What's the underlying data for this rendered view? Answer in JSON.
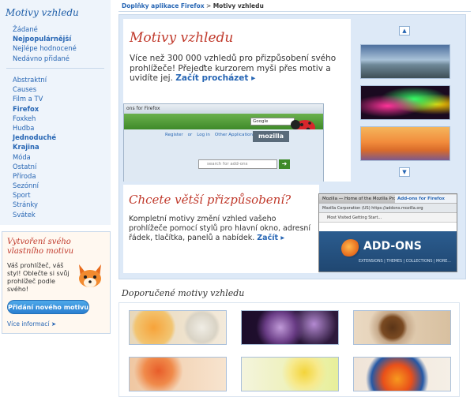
{
  "sidebar": {
    "title": "Motivy vzhledu",
    "sort_items": [
      {
        "label": "Žádané",
        "bold": false
      },
      {
        "label": "Nejpopulárnější",
        "bold": true
      },
      {
        "label": "Nejlépe hodnocené",
        "bold": false
      },
      {
        "label": "Nedávno přidané",
        "bold": false
      }
    ],
    "category_items": [
      {
        "label": "Abstraktní",
        "bold": false
      },
      {
        "label": "Causes",
        "bold": false
      },
      {
        "label": "Film a TV",
        "bold": false
      },
      {
        "label": "Firefox",
        "bold": true
      },
      {
        "label": "Foxkeh",
        "bold": false
      },
      {
        "label": "Hudba",
        "bold": false
      },
      {
        "label": "Jednoduché",
        "bold": true
      },
      {
        "label": "Krajina",
        "bold": true
      },
      {
        "label": "Móda",
        "bold": false
      },
      {
        "label": "Ostatní",
        "bold": false
      },
      {
        "label": "Příroda",
        "bold": false
      },
      {
        "label": "Sezónní",
        "bold": false
      },
      {
        "label": "Sport",
        "bold": false
      },
      {
        "label": "Stránky",
        "bold": false
      },
      {
        "label": "Svátek",
        "bold": false
      }
    ],
    "create": {
      "title": "Vytvoření svého vlastního motivu",
      "text": "Váš prohlížeč, váš styl! Oblečte si svůj prohlížeč podle svého!",
      "button": "Přidání nového motivu",
      "more": "Více informací  ➤"
    }
  },
  "breadcrumb": {
    "link": "Doplňky aplikace Firefox",
    "sep": " > ",
    "current": "Motivy vzhledu"
  },
  "featured": {
    "title": "Motivy vzhledu",
    "text": "Více než 300 000 vzhledů pro přizpůsobení svého prohlížeče! Přejeďte kurzorem myši přes motiv a uvidíte jej. ",
    "link": "Začít procházet ▸",
    "preview": {
      "titlebar": "ons for Firefox",
      "url": "Google",
      "links": [
        "Register",
        "or",
        "Log in",
        "Other Applications ▾"
      ],
      "brand": "mozilla",
      "search_placeholder": "search for add-ons",
      "go": "➜"
    },
    "arrow_up": "▲",
    "arrow_down": "▼"
  },
  "customize": {
    "title": "Chcete větší přizpůsobení?",
    "text": "Kompletní motivy změní vzhled vašeho prohlížeče pomocí stylů pro hlavní okno, adresní řádek, tlačítka, panelů a nabídek. ",
    "link": "Začít ▸",
    "window": {
      "title": "Mozilla — Home of the Mozilla Proj...",
      "tab": "Add-ons for Firefox",
      "url": "Mozilla Corporation (US)   https://addons.mozilla.org",
      "bookmarks": "Most Visited     Getting Start...",
      "brand": "ADD-ONS",
      "nav": "EXTENSIONS  |  THEMES  |  COLLECTIONS  |  MORE..."
    }
  },
  "recommended": {
    "title": "Doporučené motivy vzhledu"
  }
}
